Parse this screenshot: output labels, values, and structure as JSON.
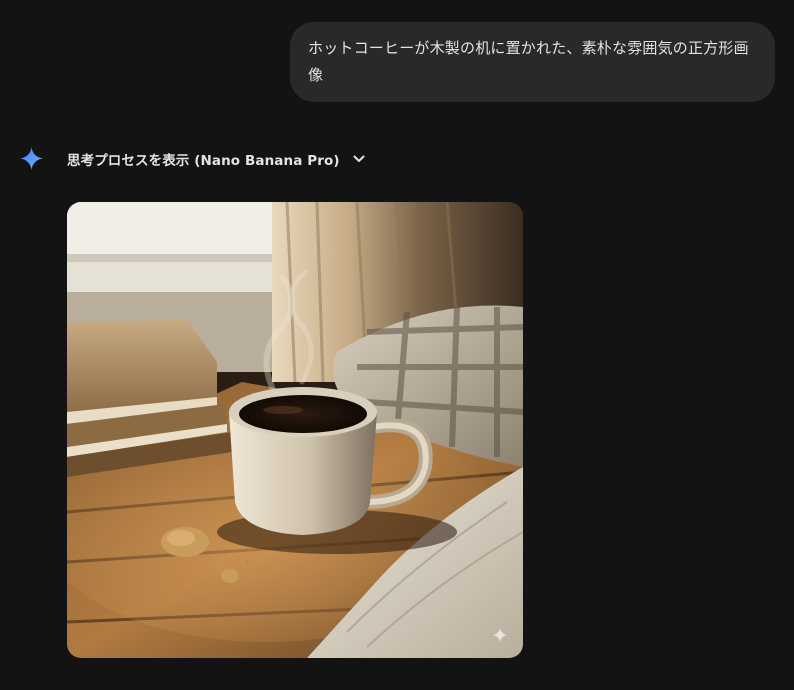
{
  "user_message": {
    "text": "ホットコーヒーが木製の机に置かれた、素朴な雰囲気の正方形画像"
  },
  "response": {
    "thinking_toggle_label": "思考プロセスを表示 (Nano Banana Pro)",
    "icons": {
      "assistant": "gemini-spark-icon",
      "toggle": "chevron-down-icon",
      "watermark": "sparkle-watermark-icon"
    },
    "colors": {
      "background": "#131314",
      "user_bubble": "#28292b",
      "spark_gradient_start": "#4f8df7",
      "spark_gradient_end": "#6aa8ff"
    }
  }
}
